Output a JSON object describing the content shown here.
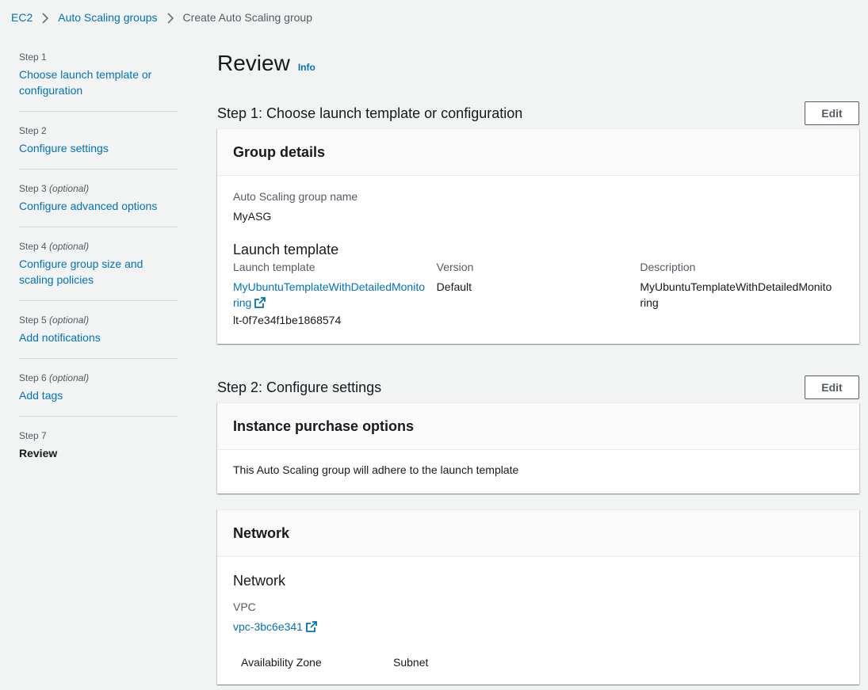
{
  "breadcrumb": {
    "items": [
      "EC2",
      "Auto Scaling groups"
    ],
    "current": "Create Auto Scaling group"
  },
  "steps": [
    {
      "num": "Step 1",
      "optional": "",
      "title": "Choose launch template or configuration"
    },
    {
      "num": "Step 2",
      "optional": "",
      "title": "Configure settings"
    },
    {
      "num": "Step 3",
      "optional": "(optional)",
      "title": "Configure advanced options"
    },
    {
      "num": "Step 4",
      "optional": "(optional)",
      "title": "Configure group size and scaling policies"
    },
    {
      "num": "Step 5",
      "optional": "(optional)",
      "title": "Add notifications"
    },
    {
      "num": "Step 6",
      "optional": "(optional)",
      "title": "Add tags"
    },
    {
      "num": "Step 7",
      "optional": "",
      "title": "Review"
    }
  ],
  "page": {
    "title": "Review",
    "info": "Info"
  },
  "section1": {
    "title": "Step 1: Choose launch template or configuration",
    "edit": "Edit",
    "card_title": "Group details",
    "asg_name_label": "Auto Scaling group name",
    "asg_name": "MyASG",
    "lt_heading": "Launch template",
    "lt_label": "Launch template",
    "lt_link": "MyUbuntuTemplateWithDetailedMonitoring",
    "lt_id": "lt-0f7e34f1be1868574",
    "version_label": "Version",
    "version": "Default",
    "desc_label": "Description",
    "desc": "MyUbuntuTemplateWithDetailedMonitoring"
  },
  "section2": {
    "title": "Step 2: Configure settings",
    "edit": "Edit",
    "purchase_title": "Instance purchase options",
    "purchase_text": "This Auto Scaling group will adhere to the launch template",
    "network_card_title": "Network",
    "network_heading": "Network",
    "vpc_label": "VPC",
    "vpc": "vpc-3bc6e341",
    "az_label": "Availability Zone",
    "subnet_label": "Subnet"
  },
  "icons": {
    "separator": "chevron-right-icon",
    "external": "external-link-icon"
  },
  "colors": {
    "link": "#0073bb",
    "text": "#16191f",
    "muted": "#545b64",
    "bg": "#f2f3f3"
  }
}
